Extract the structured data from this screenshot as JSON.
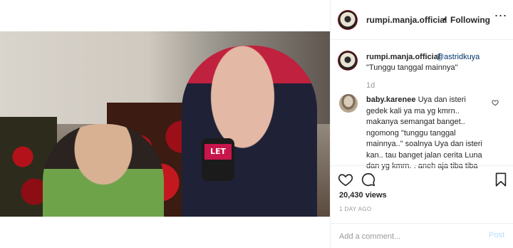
{
  "header": {
    "username": "rumpi.manja.official",
    "separator": "•",
    "follow_status": "Following",
    "more_icon": "⋯"
  },
  "caption": {
    "username": "rumpi.manja.official",
    "mention": "@astridkuya",
    "text": "\"Tunggu tanggal mainnya\"",
    "time": "1d"
  },
  "comment": {
    "username": "baby.karenee",
    "text": "Uya dan isteri gedek kali ya ma yg kmrn.. makanya semangat banget.. ngomong \"tunggu tanggal mainnya..\" soalnya Uya dan isteri kan.. tau banget jalan cerita Luna dan yg kmrn. . aneh aja tiba tiba"
  },
  "stats": {
    "views": "20,430 views",
    "date": "1 DAY AGO"
  },
  "add_comment": {
    "placeholder": "Add a comment...",
    "post_label": "Post"
  },
  "video": {
    "mic_brand": "LET"
  },
  "colors": {
    "link": "#003569",
    "muted": "#999999",
    "post_disabled": "#b2dffc"
  }
}
